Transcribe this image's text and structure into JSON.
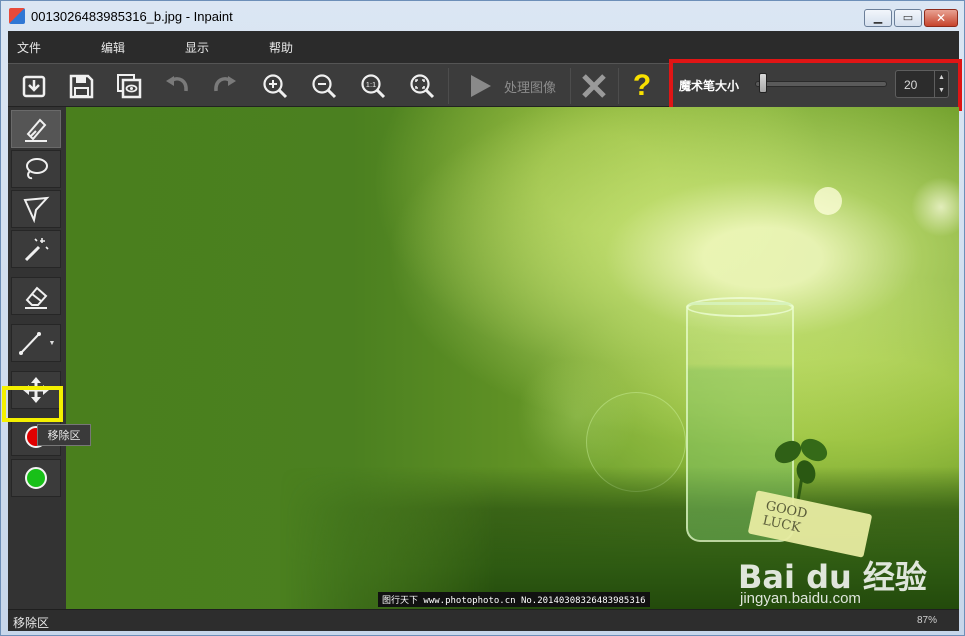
{
  "window": {
    "title": "0013026483985316_b.jpg - Inpaint",
    "minimize_icon": "minimize-icon",
    "maximize_icon": "maximize-icon",
    "close_icon": "close-icon"
  },
  "menu": [
    "文件",
    "编辑",
    "显示",
    "帮助"
  ],
  "toolbar": {
    "buttons": [
      "open-icon",
      "save-icon",
      "save-as-icon",
      "undo-icon",
      "redo-icon",
      "zoom-in-icon",
      "zoom-out-icon",
      "zoom-actual-icon",
      "zoom-fit-icon",
      "play-icon",
      "cancel-icon",
      "help-icon"
    ],
    "zoom_actual_label": "1:1",
    "process_label": "处理图像",
    "help_label": "?",
    "brush_size_label": "魔术笔大小",
    "brush_size_value": "20",
    "brush_size_fraction": 0.03
  },
  "tools": [
    "marker-icon",
    "lasso-icon",
    "polygon-lasso-icon",
    "magic-wand-icon",
    "eraser-icon",
    "line-icon",
    "move-icon",
    "remove-area-dot",
    "donor-area-dot"
  ],
  "tooltip": "移除区",
  "colors": {
    "remove": "#e00000",
    "donor": "#18c018",
    "highlight_red": "#e01515",
    "highlight_yellow": "#f4f000"
  },
  "image": {
    "note_text": "GOOD\nLUCK",
    "watermark": "图行天下 www.photophoto.cn  No.20140308326483985316",
    "baidu_logo": "Bai du 经验",
    "baidu_url": "jingyan.baidu.com"
  },
  "status": {
    "mode": "移除区",
    "zoom": "87%"
  }
}
